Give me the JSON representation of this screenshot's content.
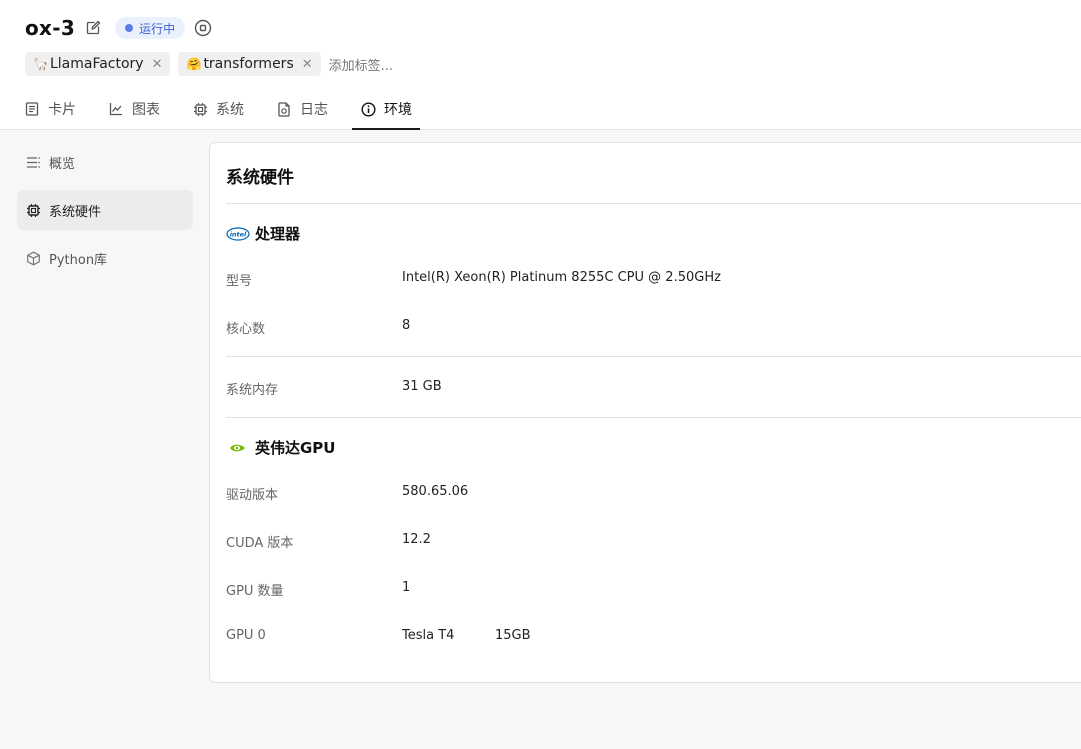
{
  "header": {
    "title": "ox-3",
    "status": "运行中",
    "tags": [
      {
        "emoji": "🦙",
        "label": "LlamaFactory"
      },
      {
        "emoji": "🤗",
        "label": "transformers"
      }
    ],
    "add_tag_placeholder": "添加标签..."
  },
  "tabs": [
    {
      "label": "卡片",
      "icon": "card-icon"
    },
    {
      "label": "图表",
      "icon": "chart-icon"
    },
    {
      "label": "系统",
      "icon": "chip-icon"
    },
    {
      "label": "日志",
      "icon": "log-icon"
    },
    {
      "label": "环境",
      "icon": "info-icon",
      "active": true
    }
  ],
  "sidebar": {
    "items": [
      {
        "label": "概览",
        "icon": "list-icon"
      },
      {
        "label": "系统硬件",
        "icon": "chip-icon",
        "active": true
      },
      {
        "label": "Python库",
        "icon": "package-icon"
      }
    ]
  },
  "panel": {
    "title": "系统硬件",
    "cpu": {
      "section_title": "处理器",
      "logo": "intel",
      "model_label": "型号",
      "model_value": "Intel(R) Xeon(R) Platinum 8255C CPU @ 2.50GHz",
      "cores_label": "核心数",
      "cores_value": "8"
    },
    "memory": {
      "label": "系统内存",
      "value": "31 GB"
    },
    "gpu": {
      "section_title": "英伟达GPU",
      "driver_label": "驱动版本",
      "driver_value": "580.65.06",
      "cuda_label": "CUDA 版本",
      "cuda_value": "12.2",
      "count_label": "GPU 数量",
      "count_value": "1",
      "gpu0_label": "GPU 0",
      "gpu0_name": "Tesla T4",
      "gpu0_memory": "15GB"
    }
  },
  "colors": {
    "status_bg": "#eaf0fc",
    "status_text": "#3d63d4",
    "intel_blue": "#0068b5",
    "nvidia_green": "#76b900"
  }
}
